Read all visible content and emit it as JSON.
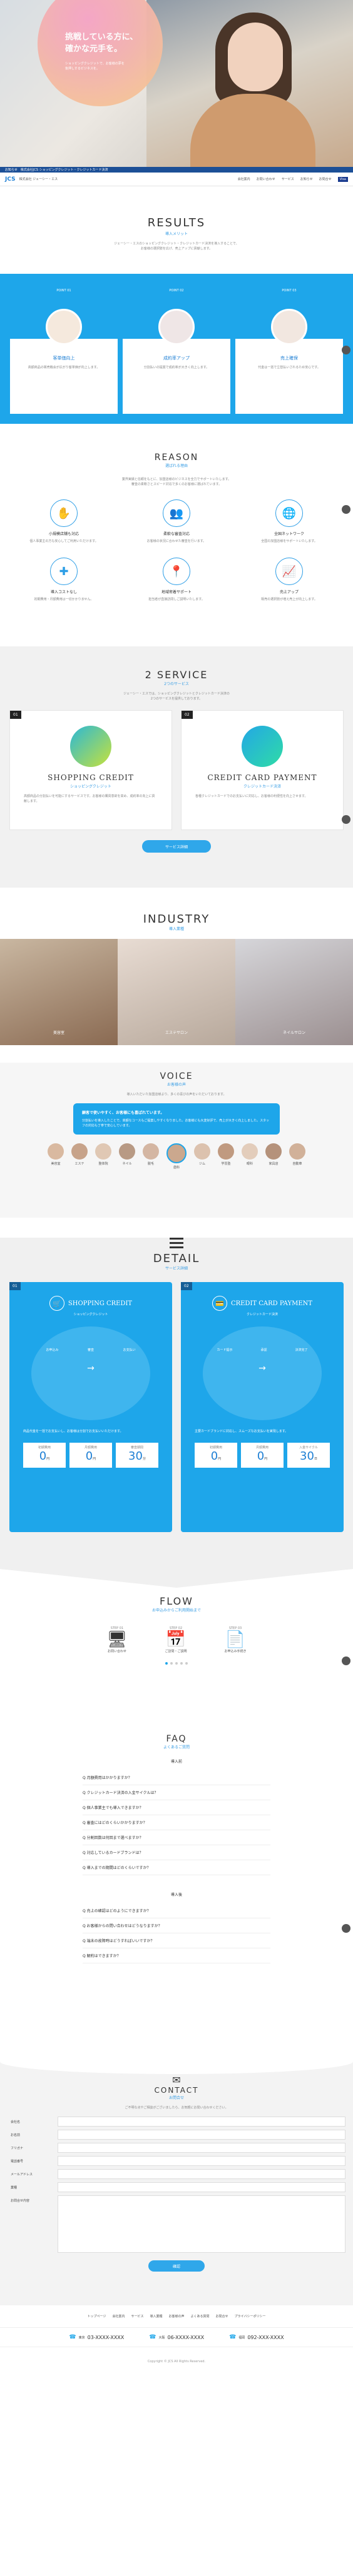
{
  "hero": {
    "headline": "挑戦している方に、\n確かな元手を。",
    "sub": "ショッピングクレジットで、お客様の夢を\n後押しするビジネスを。"
  },
  "header": {
    "company": "株式会社 ジェーシー・エス",
    "logo": "JCS",
    "nav": [
      "会社案内",
      "お問い合わせ",
      "サービス",
      "お知らせ",
      "お問合せ"
    ],
    "badge": "Visa"
  },
  "bar": {
    "text": "お知らせ　株式会社JCS ショッピングクレジット・クレジットカード決済"
  },
  "results": {
    "title": "RESULTS",
    "sub": "導入メリット",
    "desc": "ジェーシー・エスのショッピングクレジット・クレジットカード決済を導入することで、\nお客様の選択肢を広げ、売上アップに貢献します。",
    "items": [
      {
        "num": "POINT 01",
        "label": "客単価向上",
        "caption": "高額商品の販売機会が広がり客単価が向上します。"
      },
      {
        "num": "POINT 02",
        "label": "成約率アップ",
        "caption": "分割払いの提案で成約率が大きく向上します。"
      },
      {
        "num": "POINT 03",
        "label": "売上確保",
        "caption": "代金は一括で立替払いされるため安心です。"
      }
    ]
  },
  "reason": {
    "title": "REASON",
    "sub": "選ばれる理由",
    "desc": "業界実績と信頼をもとに、加盟店様のビジネスを全力でサポートいたします。\n審査の柔軟さとスピード対応で多くのお客様に選ばれています。",
    "items": [
      {
        "icon": "hand-icon",
        "label": "小規模店舗も対応",
        "caption": "個人事業主の方も安心してご利用いただけます。"
      },
      {
        "icon": "people-icon",
        "label": "柔軟な審査対応",
        "caption": "お客様の状況に合わせた審査を行います。"
      },
      {
        "icon": "globe-icon",
        "label": "全国ネットワーク",
        "caption": "全国の加盟店様をサポートいたします。"
      },
      {
        "icon": "puzzle-icon",
        "label": "導入コストなし",
        "caption": "初期費用・月額費用は一切かかりません。"
      },
      {
        "icon": "pin-icon",
        "label": "地域密着サポート",
        "caption": "担当者が直接訪問しご説明いたします。"
      },
      {
        "icon": "chart-icon",
        "label": "売上アップ",
        "caption": "販売の選択肢が増え売上が向上します。"
      }
    ]
  },
  "service": {
    "title": "2 SERVICE",
    "sub": "2つのサービス",
    "desc": "ジェーシー・エスでは、ショッピングクレジットとクレジットカード決済の\n2つのサービスを提供しております。",
    "cards": [
      {
        "num": "01",
        "name": "SHOPPING CREDIT",
        "jp": "ショッピングクレジット",
        "text": "高額商品の分割払いを可能にするサービスです。お客様の購買意欲を高め、成約率の向上に貢献します。"
      },
      {
        "num": "02",
        "name": "CREDIT CARD PAYMENT",
        "jp": "クレジットカード決済",
        "text": "各種クレジットカードでのお支払いに対応し、お客様の利便性を向上させます。"
      }
    ],
    "button": "サービス詳細"
  },
  "industry": {
    "title": "INDUSTRY",
    "sub": "導入業種",
    "items": [
      "美容室",
      "エステサロン",
      "ネイルサロン"
    ]
  },
  "voice": {
    "title": "VOICE",
    "sub": "お客様の声",
    "desc": "導入いただいた加盟店様より、多くの喜びの声をいただいております。",
    "bubble_title": "顧客で使いやすく、お客様にも喜ばれています。",
    "bubble_text": "分割払いを導入したことで、高額なコースもご提案しやすくなりました。お客様にも大変好評で、売上が大きく向上しました。スタッフの対応も丁寧で安心しています。",
    "people": [
      "美容室",
      "エステ",
      "整体院",
      "ネイル",
      "脱毛",
      "歯科",
      "ジム",
      "学習塾",
      "眼科",
      "家具店",
      "自動車"
    ]
  },
  "detail": {
    "title": "DETAIL",
    "sub": "サービス詳細",
    "cards": [
      {
        "num": "01",
        "name": "SHOPPING CREDIT",
        "jp": "ショッピングクレジット",
        "flow": [
          "お申込み",
          "審査",
          "お支払い"
        ],
        "text": "商品代金を一括でお支払いし、お客様は分割でお支払いいただけます。",
        "fees": [
          {
            "label": "初期費用",
            "value": "0",
            "unit": "円"
          },
          {
            "label": "月額費用",
            "value": "0",
            "unit": "円"
          },
          {
            "label": "審査期間",
            "value": "30",
            "unit": "分"
          }
        ]
      },
      {
        "num": "02",
        "name": "CREDIT CARD PAYMENT",
        "jp": "クレジットカード決済",
        "flow": [
          "カード提示",
          "承認",
          "決済完了"
        ],
        "text": "主要カードブランドに対応し、スムーズなお支払いを実現します。",
        "fees": [
          {
            "label": "初期費用",
            "value": "0",
            "unit": "円"
          },
          {
            "label": "月額費用",
            "value": "0",
            "unit": "円"
          },
          {
            "label": "入金サイクル",
            "value": "30",
            "unit": "日"
          }
        ]
      }
    ]
  },
  "flow": {
    "title": "FLOW",
    "sub": "お申込みからご利用開始まで",
    "steps": [
      "STEP 01",
      "STEP 02",
      "STEP 03"
    ],
    "captions": [
      "お問い合わせ",
      "ご訪問・ご説明",
      "お申込み手続き"
    ]
  },
  "faq": {
    "title": "FAQ",
    "sub": "よくあるご質問",
    "group1": "導入前",
    "group2": "導入後",
    "q1": [
      "Q 月額費用はかかりますか？",
      "Q クレジットカード決済の入金サイクルは？",
      "Q 個人事業主でも導入できますか？",
      "Q 審査にはどのくらいかかりますか？",
      "Q 分割回数は何回まで選べますか？",
      "Q 対応しているカードブランドは？",
      "Q 導入までの期間はどのくらいですか？"
    ],
    "q2": [
      "Q 売上の確認はどのようにできますか？",
      "Q お客様からの問い合わせはどうなりますか？",
      "Q 端末の故障時はどうすればいいですか？",
      "Q 解約はできますか？"
    ]
  },
  "contact": {
    "title": "CONTACT",
    "sub": "お問合せ",
    "desc": "ご不明な点やご相談がございましたら、お気軽にお問い合わせください。",
    "fields": [
      "会社名",
      "お名前",
      "フリガナ",
      "電話番号",
      "メールアドレス",
      "業種",
      "お問合せ内容"
    ],
    "button": "確認"
  },
  "footer": {
    "nav": [
      "トップページ",
      "会社案内",
      "サービス",
      "導入業種",
      "お客様の声",
      "よくある質問",
      "お問合せ",
      "プライバシーポリシー"
    ],
    "tels": [
      {
        "area": "東京",
        "tel": "03-XXXX-XXXX"
      },
      {
        "area": "大阪",
        "tel": "06-XXXX-XXXX"
      },
      {
        "area": "福岡",
        "tel": "092-XXX-XXXX"
      }
    ],
    "copy": "Copyright © JCS All Rights Reserved."
  }
}
